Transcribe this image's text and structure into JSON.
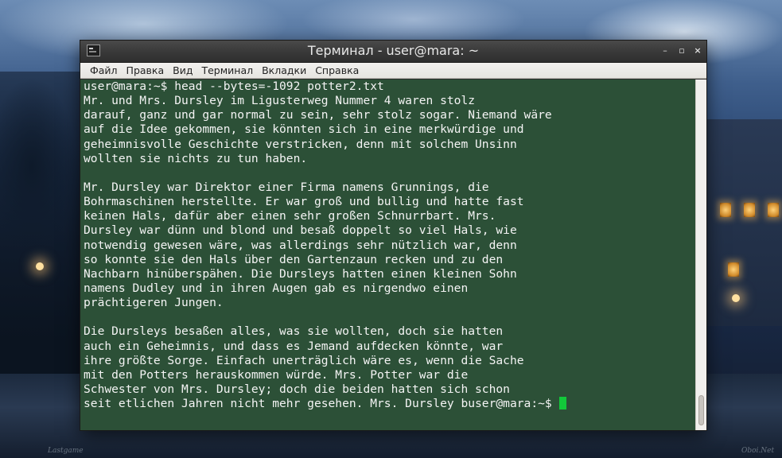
{
  "window": {
    "title": "Терминал - user@mara: ~",
    "controls": {
      "minimize": "–",
      "maximize": "▫",
      "close": "×"
    }
  },
  "menu": {
    "items": [
      "Файл",
      "Правка",
      "Вид",
      "Терминал",
      "Вкладки",
      "Справка"
    ]
  },
  "terminal": {
    "lines": [
      "user@mara:~$ head --bytes=-1092 potter2.txt",
      "Mr. und Mrs. Dursley im Ligusterweg Nummer 4 waren stolz",
      "darauf, ganz und gar normal zu sein, sehr stolz sogar. Niemand wäre",
      "auf die Idee gekommen, sie könnten sich in eine merkwürdige und",
      "geheimnisvolle Geschichte verstricken, denn mit solchem Unsinn",
      "wollten sie nichts zu tun haben.",
      "",
      "Mr. Dursley war Direktor einer Firma namens Grunnings, die",
      "Bohrmaschinen herstellte. Er war groß und bullig und hatte fast",
      "keinen Hals, dafür aber einen sehr großen Schnurrbart. Mrs.",
      "Dursley war dünn und blond und besaß doppelt so viel Hals, wie",
      "notwendig gewesen wäre, was allerdings sehr nützlich war, denn",
      "so konnte sie den Hals über den Gartenzaun recken und zu den",
      "Nachbarn hinüberspähen. Die Dursleys hatten einen kleinen Sohn",
      "namens Dudley und in ihren Augen gab es nirgendwo einen",
      "prächtigeren Jungen.",
      "",
      "Die Dursleys besaßen alles, was sie wollten, doch sie hatten",
      "auch ein Geheimnis, und dass es Jemand aufdecken könnte, war",
      "ihre größte Sorge. Einfach unerträglich wäre es, wenn die Sache",
      "mit den Potters herauskommen würde. Mrs. Potter war die",
      "Schwester von Mrs. Dursley; doch die beiden hatten sich schon"
    ],
    "last_line": "seit etlichen Jahren nicht mehr gesehen. Mrs. Dursley buser@mara:~$ ",
    "colors": {
      "background": "#2c5037",
      "foreground": "#f4f4f4",
      "cursor": "#12c93a"
    }
  },
  "scrollbar": {
    "position": 0.97
  },
  "watermarks": {
    "left": "Lastgame",
    "right": "Oboi.Net"
  },
  "icons": {
    "app": "terminal-icon",
    "minimize": "minimize-icon",
    "maximize": "maximize-icon",
    "close": "close-icon"
  }
}
